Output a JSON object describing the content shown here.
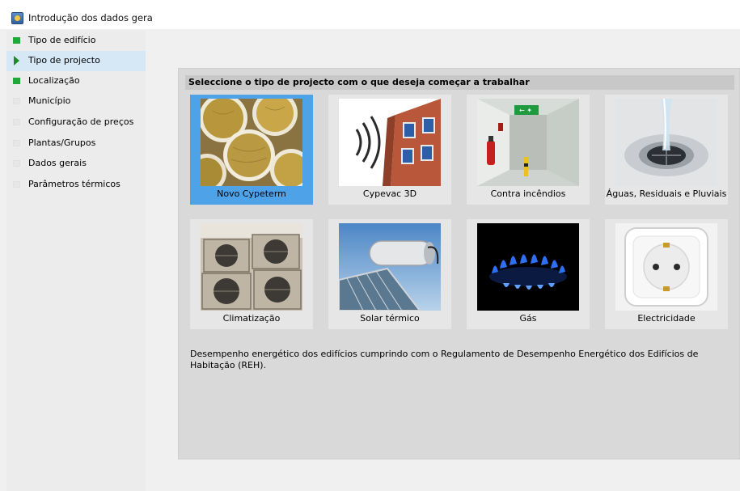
{
  "window": {
    "title": "Introdução dos dados gera"
  },
  "sidebar": {
    "items": [
      {
        "label": "Tipo de edifício",
        "marker": "green",
        "active": false
      },
      {
        "label": "Tipo de projecto",
        "marker": "arrow",
        "active": true
      },
      {
        "label": "Localização",
        "marker": "green",
        "active": false
      },
      {
        "label": "Município",
        "marker": "faint",
        "active": false
      },
      {
        "label": "Configuração de preços",
        "marker": "faint",
        "active": false
      },
      {
        "label": "Plantas/Grupos",
        "marker": "faint",
        "active": false
      },
      {
        "label": "Dados gerais",
        "marker": "faint",
        "active": false
      },
      {
        "label": "Parâmetros térmicos",
        "marker": "faint",
        "active": false
      }
    ]
  },
  "main": {
    "header": "Seleccione o tipo de projecto com o que deseja começar a trabalhar",
    "tiles": [
      {
        "label": "Novo Cypeterm",
        "image": "insulation-rolls-image",
        "selected": true
      },
      {
        "label": "Cypevac 3D",
        "image": "acoustic-waves-building-image",
        "selected": false
      },
      {
        "label": "Contra incêndios",
        "image": "fire-extinguisher-corridor-image",
        "selected": false
      },
      {
        "label": "Águas, Residuais e Pluviais",
        "image": "water-drain-image",
        "selected": false
      },
      {
        "label": "Climatização",
        "image": "air-conditioning-units-image",
        "selected": false
      },
      {
        "label": "Solar térmico",
        "image": "solar-water-heater-image",
        "selected": false
      },
      {
        "label": "Gás",
        "image": "gas-flame-image",
        "selected": false
      },
      {
        "label": "Electricidade",
        "image": "power-socket-image",
        "selected": false
      }
    ],
    "description": "Desempenho energético dos edifícios cumprindo com o Regulamento de Desempenho Energético dos Edifícios de Habitação (REH)."
  },
  "colors": {
    "selected_tile": "#4ea3e8",
    "active_nav": "#d6e8f6",
    "marker_green": "#22a83a"
  }
}
